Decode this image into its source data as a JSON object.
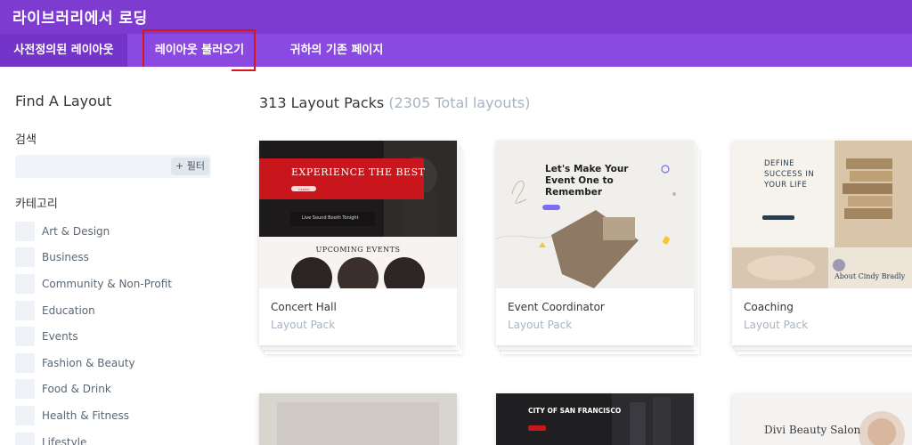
{
  "header": {
    "title": "라이브러리에서 로딩"
  },
  "tabs": [
    {
      "label": "사전정의된 레이아웃",
      "active": true
    },
    {
      "label": "레이아웃 불러오기",
      "active": false
    },
    {
      "label": "귀하의 기존 페이지",
      "active": false
    }
  ],
  "sidebar": {
    "title": "Find A Layout",
    "search_label": "검색",
    "search_placeholder": "",
    "filter_label": "+ 필터",
    "category_label": "카테고리",
    "categories": [
      "Art & Design",
      "Business",
      "Community & Non-Profit",
      "Education",
      "Events",
      "Fashion & Beauty",
      "Food & Drink",
      "Health & Fitness",
      "Lifestyle"
    ]
  },
  "main": {
    "heading": "313 Layout Packs",
    "total": "(2305 Total layouts)",
    "cards": [
      {
        "title": "Concert Hall",
        "subtitle": "Layout Pack",
        "thumb": {
          "banner": "EXPERIENCE THE BEST",
          "btn": "TICKETS",
          "tagline": "Live Sound Booth Tonight",
          "section": "UPCOMING EVENTS"
        }
      },
      {
        "title": "Event Coordinator",
        "subtitle": "Layout Pack",
        "thumb": {
          "heading1": "Let's Make Your",
          "heading2": "Event One to",
          "heading3": "Remember"
        }
      },
      {
        "title": "Coaching",
        "subtitle": "Layout Pack",
        "thumb": {
          "line1": "DEFINE",
          "line2": "SUCCESS IN",
          "line3": "YOUR LIFE",
          "about": "About Cindy Bradly"
        }
      }
    ],
    "bottom_cards": [
      {
        "text": ""
      },
      {
        "text": "CITY OF SAN FRANCISCO"
      },
      {
        "text": "Divi Beauty Salon"
      }
    ]
  },
  "colors": {
    "topbar": "#7e3bd0",
    "tabs": "#8a49e0",
    "highlight": "#d8161b",
    "concert_red": "#c8161c"
  }
}
